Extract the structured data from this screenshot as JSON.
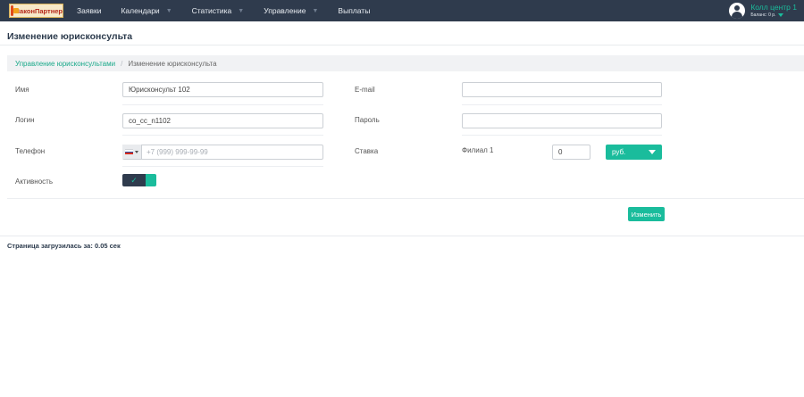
{
  "brand": {
    "logo_text": "ЗаконПартнер"
  },
  "nav": {
    "items": [
      {
        "label": "Заявки",
        "has_dropdown": false
      },
      {
        "label": "Календари",
        "has_dropdown": true
      },
      {
        "label": "Статистика",
        "has_dropdown": true
      },
      {
        "label": "Управление",
        "has_dropdown": true
      },
      {
        "label": "Выплаты",
        "has_dropdown": false
      }
    ]
  },
  "user": {
    "name": "Колл центр 1",
    "balance": "Баланс: 0 р."
  },
  "page": {
    "title": "Изменение юрисконсульта"
  },
  "breadcrumb": {
    "link": "Управление юрисконсультами",
    "separator": "/",
    "current": "Изменение юрисконсульта"
  },
  "form": {
    "name": {
      "label": "Имя",
      "value": "Юрисконсульт 102"
    },
    "email": {
      "label": "E-mail",
      "value": ""
    },
    "login": {
      "label": "Логин",
      "value": "co_cc_n1102"
    },
    "password": {
      "label": "Пароль",
      "value": ""
    },
    "phone": {
      "label": "Телефон",
      "value": "",
      "placeholder": "+7 (999) 999-99-99"
    },
    "rate": {
      "label": "Ставка",
      "branch": "Филиал 1",
      "value": "0",
      "currency": "руб."
    },
    "active": {
      "label": "Активность",
      "checked": true
    },
    "submit_label": "Изменить"
  },
  "footer": {
    "load_time": "Страница загрузилась за: 0.05 сек"
  },
  "colors": {
    "accent": "#1abc9c",
    "navbar": "#2f3b4d"
  }
}
